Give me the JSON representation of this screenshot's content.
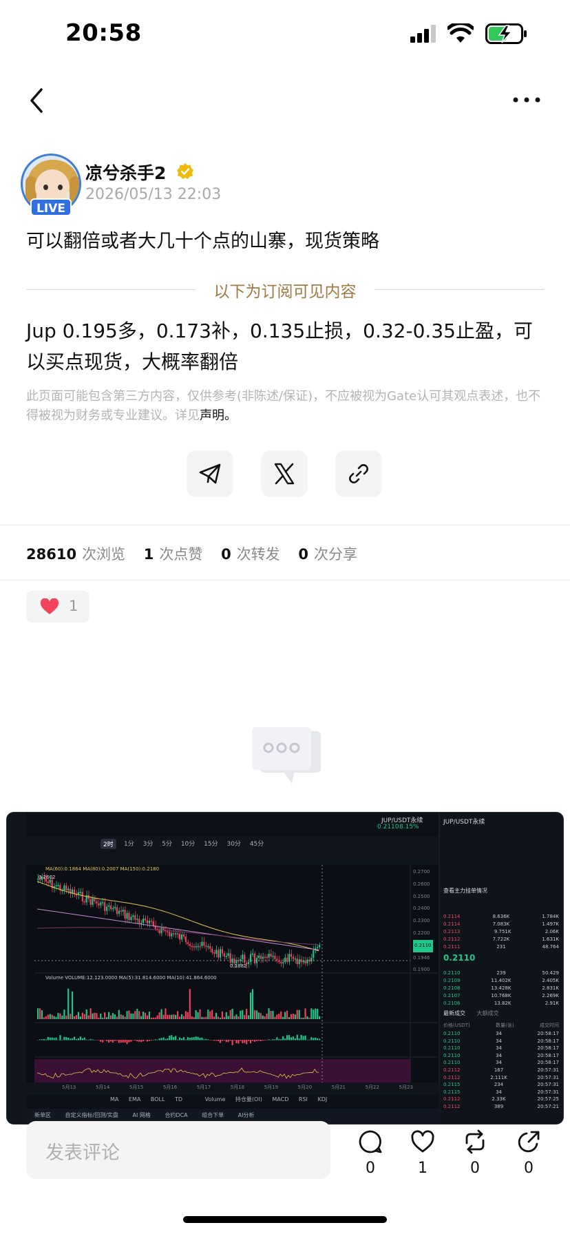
{
  "status_bar": {
    "time": "20:58"
  },
  "author": {
    "name": "凉兮杀手2",
    "live_label": "LIVE",
    "time": "2026/05/13 22:03"
  },
  "post": {
    "title": "可以翻倍或者大几十个点的山寨，现货策略",
    "subscribe_divider": "以下为订阅可见内容",
    "body": "Jup 0.195多，0.173补，0.135止损，0.32-0.35止盈，可以买点现货，大概率翻倍",
    "disclaimer": "此页面可能包含第三方内容，仅供参考(非陈述/保证)，不应被视为Gate认可其观点表述，也不得被视为财务或专业建议。详见",
    "disclaimer_link": "声明。"
  },
  "share": {
    "icons": [
      "telegram-icon",
      "x-icon",
      "link-icon"
    ]
  },
  "stats": [
    {
      "num": "28610",
      "label": "次浏览"
    },
    {
      "num": "1",
      "label": "次点赞"
    },
    {
      "num": "0",
      "label": "次转发"
    },
    {
      "num": "0",
      "label": "次分享"
    }
  ],
  "reaction": {
    "count": "1"
  },
  "chart": {
    "pair": "JUP/USDT永续",
    "price": "0.2110",
    "change": "8.15%",
    "tabs": [
      "1分",
      "3分",
      "5分",
      "10分",
      "15分",
      "30分",
      "45分"
    ],
    "active_tab": "2时",
    "ma_label": "MA(60):0.1864  MA(80):0.2007  MA(150):0.2180",
    "volume_label": "Volume  VOLUME:12.123.0000  MA(5):31.814.6000  MA(10):41.864.6000",
    "low_label": "0.1882",
    "high_label": "0.2602",
    "y_ticks": [
      "0.2700",
      "0.2600",
      "0.2500",
      "0.2400",
      "0.2300",
      "0.2200",
      "0.2110",
      "0.1946",
      "0.1900"
    ],
    "dates": [
      "5月13",
      "5月14",
      "5月15",
      "5月16",
      "5月17",
      "5月18",
      "5月19",
      "5月20",
      "5月21",
      "5月22",
      "5月23"
    ],
    "indicators": [
      "MA",
      "EMA",
      "BOLL",
      "TD",
      "Volume",
      "持仓量(OI)",
      "MACD",
      "RSI",
      "KDJ"
    ],
    "bottom_tabs": [
      "新单区",
      "自定义指标/回测/实盘",
      "AI 网格",
      "合约DCA",
      "组合下单",
      "AI分析"
    ],
    "orderbook_title": "JUP/USDT永续",
    "orderbook_subtitle": "查看主力挂单情况",
    "orderbook_price": "0.2110",
    "asks": [
      {
        "price": "0.2114",
        "qty": "8.636K",
        "total": "1.784K"
      },
      {
        "price": "0.2114",
        "qty": "7.083K",
        "total": "1.497K"
      },
      {
        "price": "0.2113",
        "qty": "9.751K",
        "total": "2.06K"
      },
      {
        "price": "0.2112",
        "qty": "7.722K",
        "total": "1.631K"
      },
      {
        "price": "0.2111",
        "qty": "231",
        "total": "48.764"
      }
    ],
    "bids": [
      {
        "price": "0.2110",
        "qty": "239",
        "total": "50.429"
      },
      {
        "price": "0.2109",
        "qty": "11.402K",
        "total": "2.405K"
      },
      {
        "price": "0.2108",
        "qty": "13.428K",
        "total": "2.831K"
      },
      {
        "price": "0.2107",
        "qty": "10.768K",
        "total": "2.269K"
      },
      {
        "price": "0.2106",
        "qty": "13.82K",
        "total": "2.91K"
      }
    ],
    "trades_tabs": [
      "最新成交",
      "大额成交"
    ],
    "trades_header": [
      "价格(USDT)",
      "数量(张)",
      "成交时间"
    ],
    "trades": [
      {
        "price": "0.2110",
        "qty": "34",
        "time": "20:58:17"
      },
      {
        "price": "0.2110",
        "qty": "34",
        "time": "20:58:17"
      },
      {
        "price": "0.2110",
        "qty": "34",
        "time": "20:58:17"
      },
      {
        "price": "0.2110",
        "qty": "34",
        "time": "20:58:17"
      },
      {
        "price": "0.2110",
        "qty": "34",
        "time": "20:58:17"
      },
      {
        "price": "0.2112",
        "qty": "167",
        "time": "20:57:31"
      },
      {
        "price": "0.2112",
        "qty": "2.111K",
        "time": "20:57:31"
      },
      {
        "price": "0.2115",
        "qty": "234",
        "time": "20:57:31"
      },
      {
        "price": "0.2115",
        "qty": "34",
        "time": "20:57:31"
      },
      {
        "price": "0.2112",
        "qty": "2.33K",
        "time": "20:57:25"
      },
      {
        "price": "0.2112",
        "qty": "389",
        "time": "20:57:21"
      }
    ]
  },
  "comment": {
    "placeholder": "发表评论"
  },
  "actions": [
    {
      "name": "comment",
      "count": "0"
    },
    {
      "name": "like",
      "count": "1"
    },
    {
      "name": "repost",
      "count": "0"
    },
    {
      "name": "share",
      "count": "0"
    }
  ],
  "colors": {
    "accent_gold": "#a07a3e",
    "live_blue": "#2f6fe0",
    "up_green": "#1ec98a",
    "down_red": "#f2435c"
  }
}
